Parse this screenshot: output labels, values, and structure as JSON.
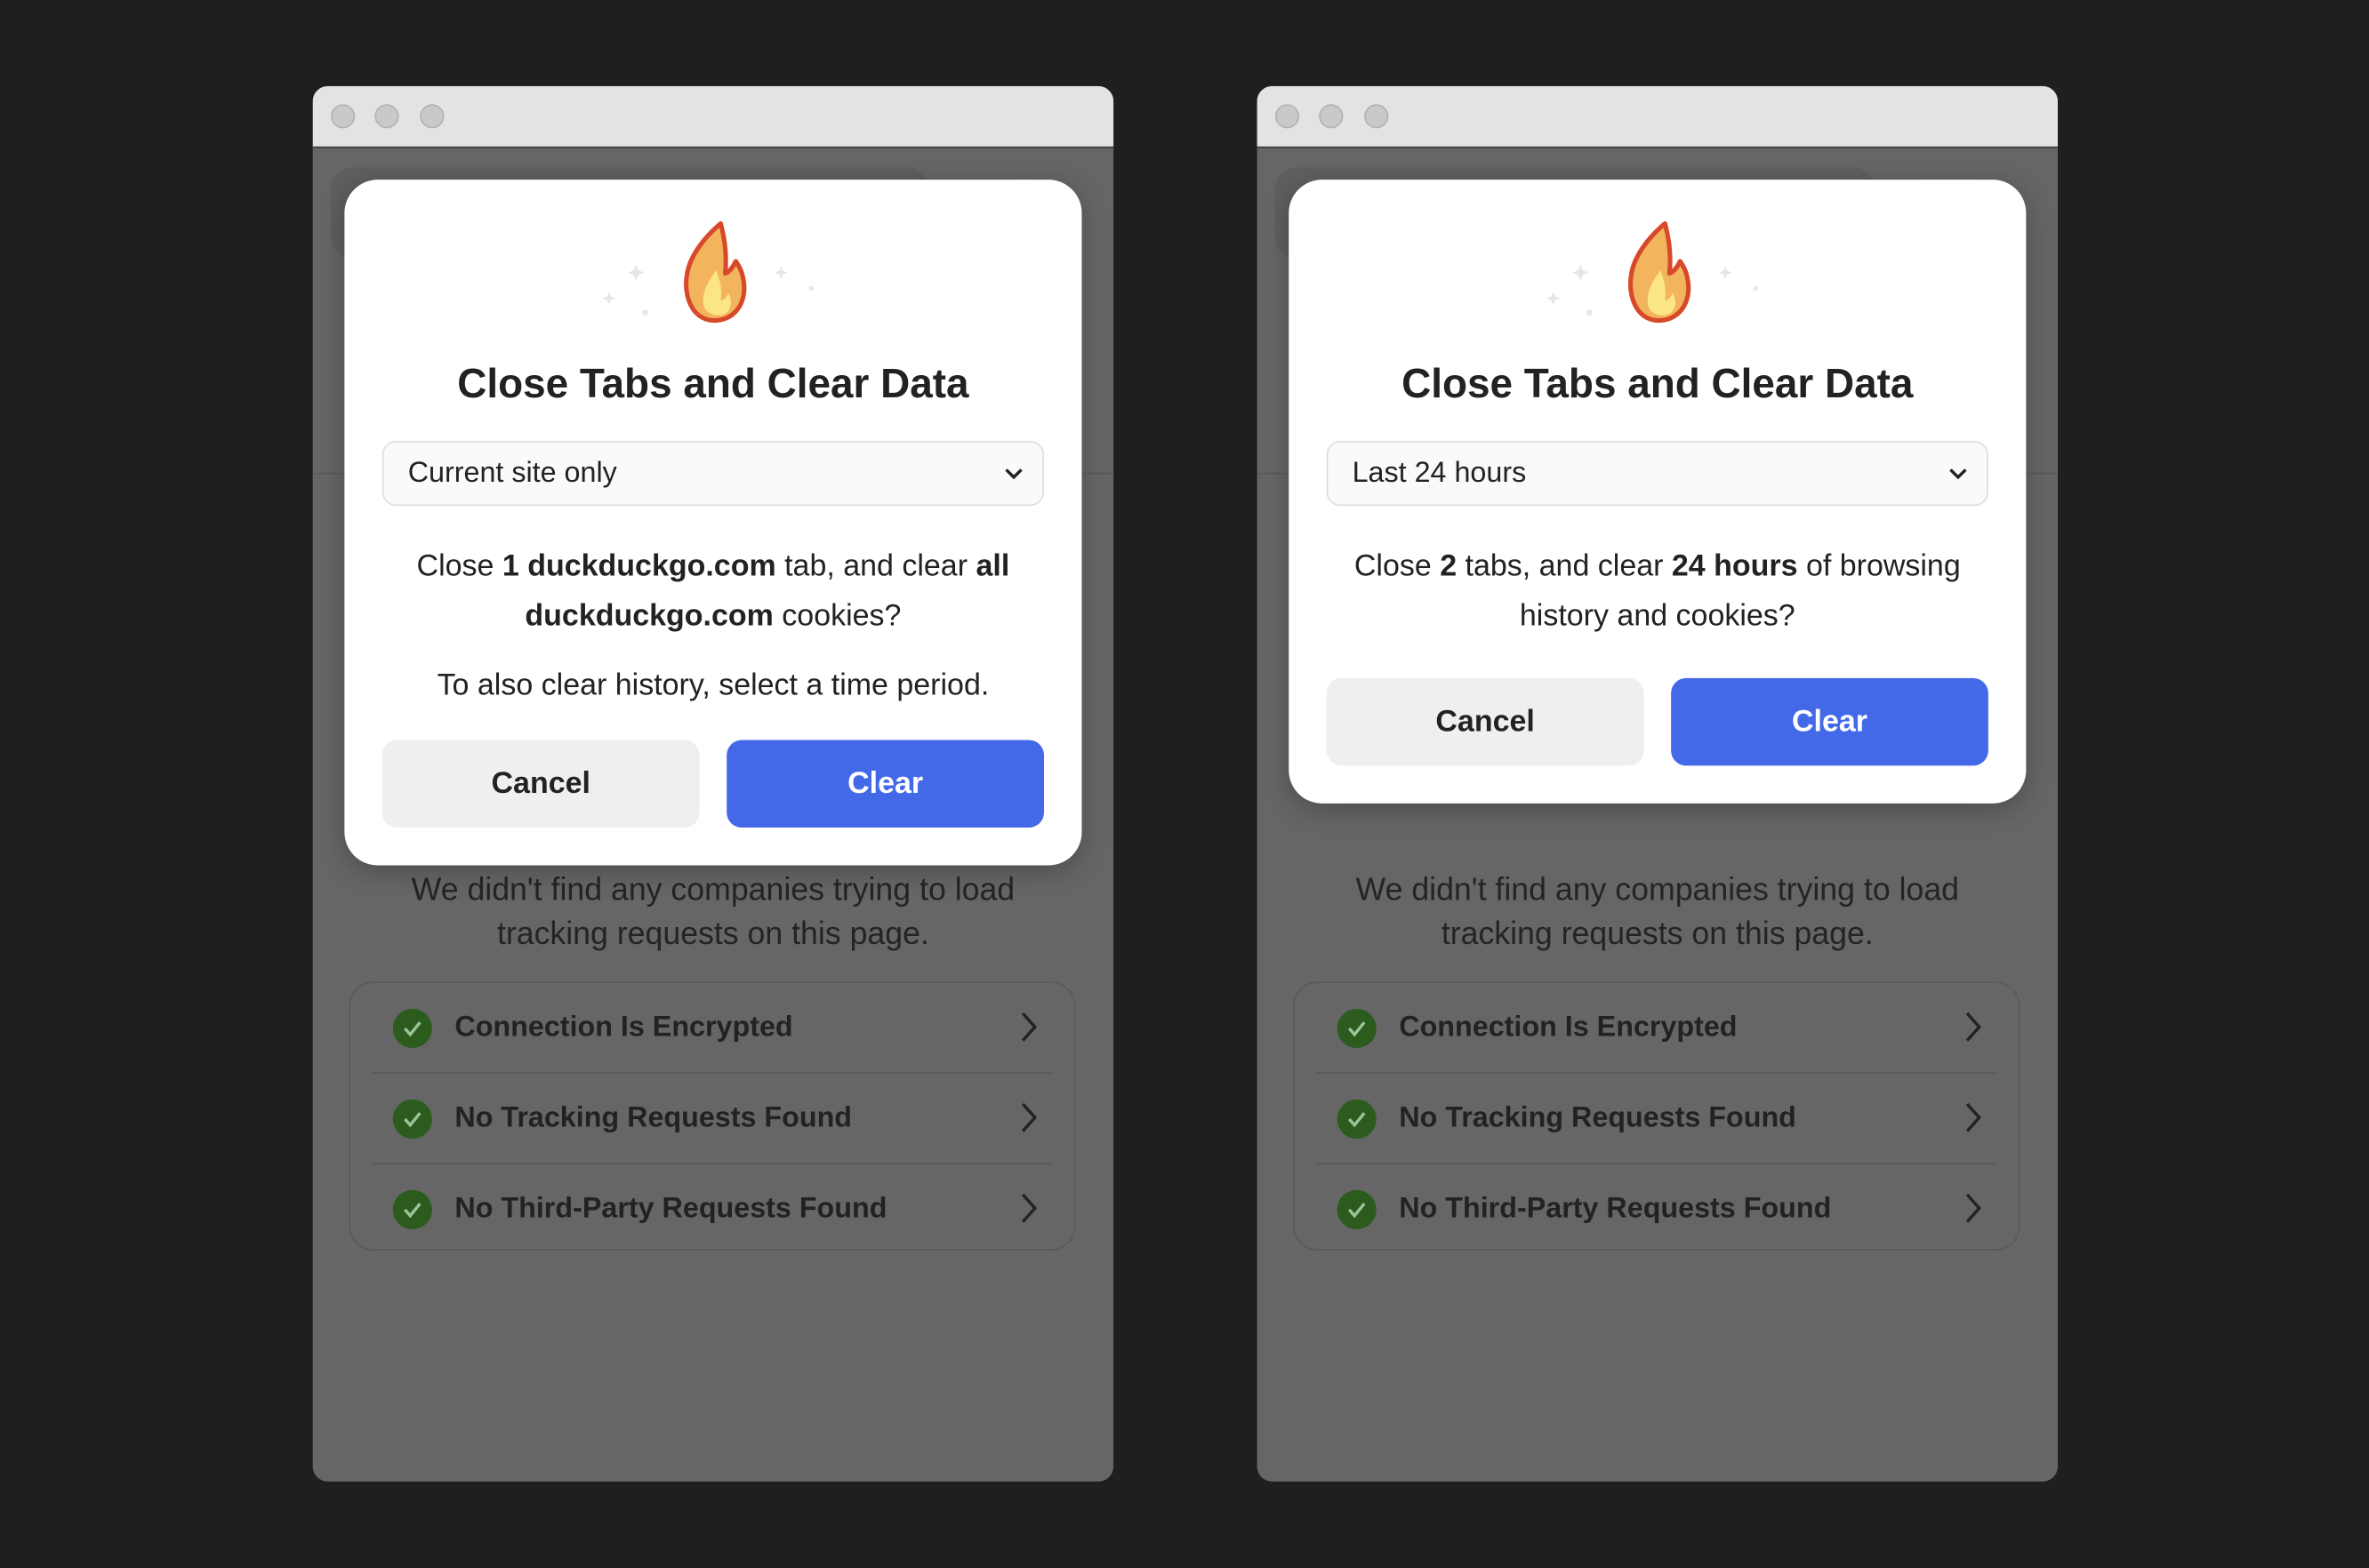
{
  "windows": [
    {
      "background": {
        "message": "We didn't find any companies trying to load tracking requests on this page.",
        "items": [
          {
            "label": "Connection Is Encrypted",
            "icon": "check-circle-icon"
          },
          {
            "label": "No Tracking Requests Found",
            "icon": "check-circle-icon"
          },
          {
            "label": "No Third-Party Requests Found",
            "icon": "check-circle-icon"
          }
        ]
      },
      "dialog": {
        "icon": "fire-icon",
        "title": "Close Tabs and Clear Data",
        "select_value": "Current site only",
        "message": [
          {
            "t": "Close ",
            "b": false
          },
          {
            "t": "1 duckduckgo.com",
            "b": true
          },
          {
            "t": " tab, and clear ",
            "b": false
          },
          {
            "t": "all duckduckgo.com",
            "b": true
          },
          {
            "t": " cookies?",
            "b": false
          }
        ],
        "hint": "To also clear history, select a time period.",
        "cancel_label": "Cancel",
        "clear_label": "Clear"
      }
    },
    {
      "background": {
        "message": "We didn't find any companies trying to load tracking requests on this page.",
        "items": [
          {
            "label": "Connection Is Encrypted",
            "icon": "check-circle-icon"
          },
          {
            "label": "No Tracking Requests Found",
            "icon": "check-circle-icon"
          },
          {
            "label": "No Third-Party Requests Found",
            "icon": "check-circle-icon"
          }
        ]
      },
      "dialog": {
        "icon": "fire-icon",
        "title": "Close Tabs and Clear Data",
        "select_value": "Last 24 hours",
        "message": [
          {
            "t": "Close ",
            "b": false
          },
          {
            "t": "2",
            "b": true
          },
          {
            "t": " tabs, and clear ",
            "b": false
          },
          {
            "t": "24 hours",
            "b": true
          },
          {
            "t": " of browsing history and cookies?",
            "b": false
          }
        ],
        "cancel_label": "Cancel",
        "clear_label": "Clear"
      }
    }
  ],
  "colors": {
    "accent": "#4469e8",
    "check": "#2b5c1e",
    "overlay": "#666666"
  }
}
